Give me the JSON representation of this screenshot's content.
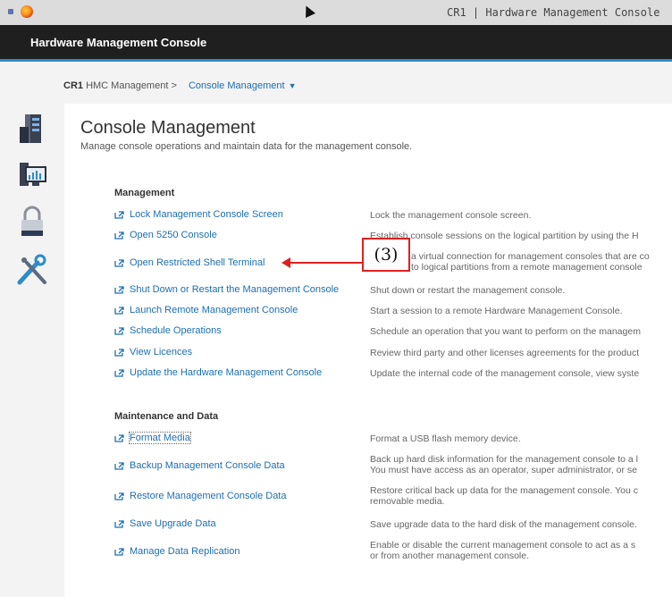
{
  "window": {
    "title": "CR1 | Hardware Management Console"
  },
  "app": {
    "title": "Hardware Management Console"
  },
  "breadcrumb": {
    "system": "CR1",
    "parent": "HMC Management >",
    "current": "Console Management"
  },
  "page": {
    "title": "Console Management",
    "subtitle": "Manage console operations and maintain data for the management console."
  },
  "callout": {
    "label": "(3)"
  },
  "icons": {
    "task_link": "external-link-icon",
    "accent": "#2d8bc7",
    "link": "#1d6fb0",
    "callout": "#e02020"
  },
  "sections": [
    {
      "title": "Management",
      "tasks": [
        {
          "label": "Lock Management Console Screen",
          "desc": [
            "Lock the management console screen."
          ]
        },
        {
          "label": "Open 5250 Console",
          "desc": [
            "Establish console sessions on the logical partition by using the H"
          ]
        },
        {
          "label": "Open Restricted Shell Terminal",
          "desc": [
            "a virtual connection for management consoles that are co",
            "to logical partitions from a remote management console"
          ]
        },
        {
          "label": "Shut Down or Restart the Management Console",
          "desc": [
            "Shut down or restart the management console."
          ]
        },
        {
          "label": "Launch Remote Management Console",
          "desc": [
            "Start a session to a remote Hardware Management Console."
          ]
        },
        {
          "label": "Schedule Operations",
          "desc": [
            "Schedule an operation that you want to perform on the managem"
          ]
        },
        {
          "label": "View Licences",
          "desc": [
            "Review third party and other licenses agreements for the product"
          ]
        },
        {
          "label": "Update the Hardware Management Console",
          "desc": [
            "Update the internal code of the management console, view syste"
          ]
        }
      ]
    },
    {
      "title": "Maintenance and Data",
      "tasks": [
        {
          "label": "Format Media",
          "desc": [
            "Format a USB flash memory device."
          ]
        },
        {
          "label": "Backup Management Console Data",
          "desc": [
            "Back up hard disk information for the management console to a l",
            "You must have access as an operator, super administrator, or se"
          ]
        },
        {
          "label": "Restore Management Console Data",
          "desc": [
            "Restore critical back up data for the management console. You c",
            "removable media."
          ]
        },
        {
          "label": "Save Upgrade Data",
          "desc": [
            "Save upgrade data to the hard disk of the management console."
          ]
        },
        {
          "label": "Manage Data Replication",
          "desc": [
            "Enable or disable the current management console to act as a s",
            "or from another management console."
          ]
        }
      ]
    }
  ]
}
